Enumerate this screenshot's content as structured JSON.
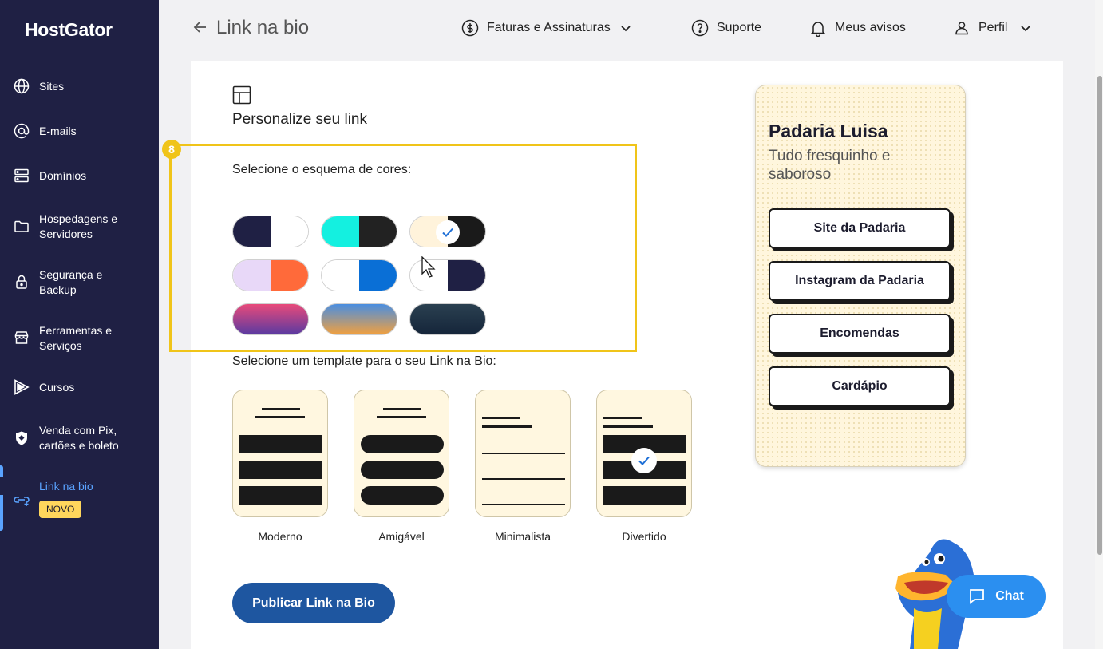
{
  "app": {
    "logo": "HostGator"
  },
  "sidebar": {
    "items": [
      {
        "label": "Sites",
        "icon": "globe-icon"
      },
      {
        "label": "E-mails",
        "icon": "at-sign-icon"
      },
      {
        "label": "Domínios",
        "icon": "server-icon"
      },
      {
        "label": "Hospedagens e\nServidores",
        "icon": "folder-icon"
      },
      {
        "label": "Segurança e\nBackup",
        "icon": "lock-icon"
      },
      {
        "label": "Ferramentas e\nServiços",
        "icon": "store-icon"
      },
      {
        "label": "Cursos",
        "icon": "play-icon"
      },
      {
        "label": "Venda com Pix,\ncartões e boleto",
        "icon": "shield-icon"
      },
      {
        "label": "Link na bio",
        "icon": "link-icon",
        "badge": "NOVO",
        "active": true
      }
    ]
  },
  "header": {
    "title": "Link na bio",
    "billing": "Faturas e Assinaturas",
    "support": "Suporte",
    "notices": "Meus avisos",
    "profile": "Perfil"
  },
  "main": {
    "section_title": "Personalize seu link",
    "step_number": "8",
    "color_label": "Selecione o esquema de cores:",
    "color_schemes": [
      {
        "left": "#1f2044",
        "right": "#ffffff",
        "selected": false
      },
      {
        "left": "#14f0e0",
        "right": "#222222",
        "selected": false
      },
      {
        "left": "#fff3db",
        "right": "#1a1a1a",
        "selected": true
      },
      {
        "left": "#e8d8f8",
        "right": "#ff6a3a",
        "selected": false
      },
      {
        "left": "#ffffff",
        "right": "#0a6fd6",
        "selected": false
      },
      {
        "left": "#ffffff",
        "right": "#1f2044",
        "selected": false
      },
      {
        "gradient": [
          "#e84a7a",
          "#5a3aa0"
        ],
        "selected": false
      },
      {
        "gradient": [
          "#4a8ee0",
          "#f0a040"
        ],
        "selected": false
      },
      {
        "gradient": [
          "#1a2a3a",
          "#2a4a5a"
        ],
        "selected": false
      }
    ],
    "template_label": "Selecione um template para o seu Link na Bio:",
    "templates": [
      {
        "name": "Moderno",
        "selected": false
      },
      {
        "name": "Amigável",
        "selected": false
      },
      {
        "name": "Minimalista",
        "selected": false
      },
      {
        "name": "Divertido",
        "selected": true
      }
    ],
    "publish_label": "Publicar Link na Bio"
  },
  "preview": {
    "title": "Padaria Luisa",
    "subtitle": "Tudo fresquinho e saboroso",
    "buttons": [
      "Site da Padaria",
      "Instagram da Padaria",
      "Encomendas",
      "Cardápio"
    ]
  },
  "chat": {
    "label": "Chat"
  },
  "colors": {
    "sidebar": "#1f2044",
    "accent": "#1e56a0",
    "highlight": "#f0c419",
    "chat": "#2b8ff0"
  }
}
